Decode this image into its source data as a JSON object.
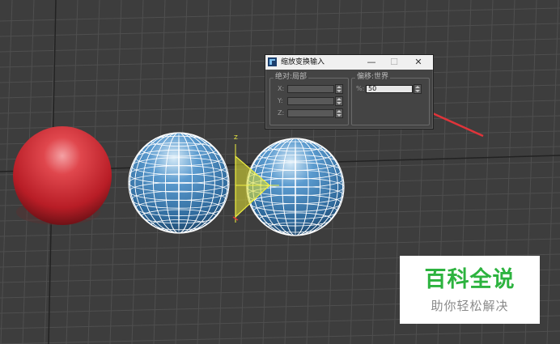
{
  "dialog": {
    "title": "缩放变换输入",
    "minimize_glyph": "—",
    "maximize_glyph": "☐",
    "close_glyph": "✕",
    "absolute_group": {
      "label": "绝对:局部",
      "rows": [
        {
          "label": "X:",
          "value": ""
        },
        {
          "label": "Y:",
          "value": ""
        },
        {
          "label": "Z:",
          "value": ""
        }
      ]
    },
    "offset_group": {
      "label": "偏移:世界",
      "percent_label": "%:",
      "percent_value": "50"
    }
  },
  "viewport": {
    "gizmo_axis_label": "Z"
  },
  "watermark": {
    "title": "百科全说",
    "subtitle": "助你轻松解决"
  },
  "colors": {
    "viewport_bg": "#3d3d3d",
    "red_sphere": "#c0202a",
    "blue_sphere": "#3f7bb0",
    "wire": "#ffffff",
    "gizmo": "#e6e632",
    "arrow": "#e0343a",
    "watermark_green": "#2db33f"
  },
  "icons": [
    "app-3dsmax-icon",
    "minimize-icon",
    "maximize-icon",
    "close-icon",
    "spinner-up-icon",
    "spinner-down-icon"
  ]
}
